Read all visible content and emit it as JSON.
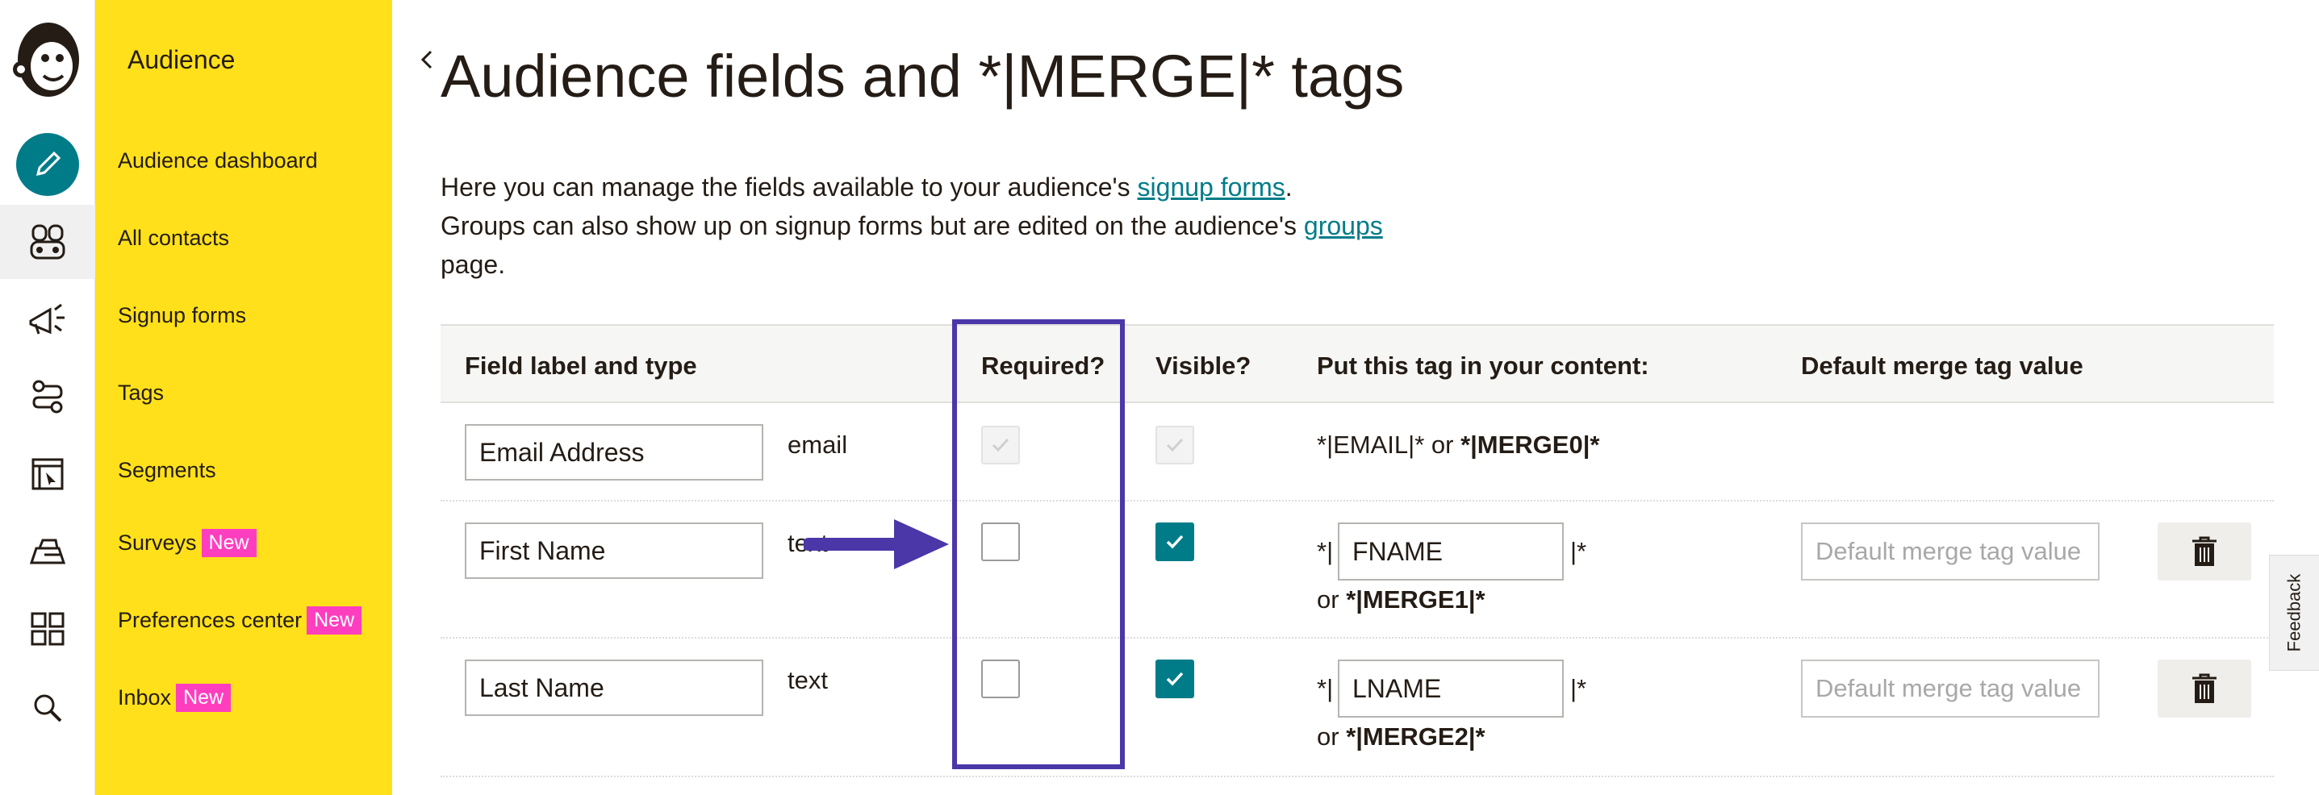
{
  "colors": {
    "brand_yellow": "#ffe01b",
    "teal": "#007c89",
    "badge_pink": "#ff3ebf",
    "annotation_purple": "#4b37a8"
  },
  "rail": {
    "icons": [
      "mailchimp-logo-icon",
      "create-pencil-icon",
      "audience-icon",
      "campaigns-megaphone-icon",
      "automations-icon",
      "website-icon",
      "integrations-icon",
      "apps-grid-icon",
      "search-icon"
    ]
  },
  "subnav": {
    "title": "Audience",
    "items": [
      {
        "label": "Audience dashboard",
        "badge": ""
      },
      {
        "label": "All contacts",
        "badge": ""
      },
      {
        "label": "Signup forms",
        "badge": ""
      },
      {
        "label": "Tags",
        "badge": ""
      },
      {
        "label": "Segments",
        "badge": ""
      },
      {
        "label": "Surveys",
        "badge": "New"
      },
      {
        "label": "Preferences center",
        "badge": "New"
      },
      {
        "label": "Inbox",
        "badge": "New"
      }
    ]
  },
  "page": {
    "title": "Audience fields and *|MERGE|* tags",
    "intro_1": "Here you can manage the fields available to your audience's ",
    "intro_link_1": "signup forms",
    "intro_1_end": ".",
    "intro_2": "Groups can also show up on signup forms but are edited on the audience's ",
    "intro_link_2": "groups",
    "intro_2_end": "page."
  },
  "table": {
    "headers": [
      "Field label and type",
      "Required?",
      "Visible?",
      "Put this tag in your content:",
      "Default merge tag value"
    ],
    "rows": [
      {
        "label": "Email Address",
        "type": "email",
        "required": true,
        "visible": true,
        "locked": true,
        "tag_text": "*|EMAIL|* or ",
        "merge": "*|MERGE0|*",
        "editable_tag": "",
        "default_placeholder": ""
      },
      {
        "label": "First Name",
        "type": "text",
        "required": false,
        "visible": true,
        "locked": false,
        "tag_prefix": "*|",
        "editable_tag": "FNAME",
        "tag_suffix": "|*",
        "or_text": "or ",
        "merge": "*|MERGE1|*",
        "default_placeholder": "Default merge tag value"
      },
      {
        "label": "Last Name",
        "type": "text",
        "required": false,
        "visible": true,
        "locked": false,
        "tag_prefix": "*|",
        "editable_tag": "LNAME",
        "tag_suffix": "|*",
        "or_text": "or ",
        "merge": "*|MERGE2|*",
        "default_placeholder": "Default merge tag value"
      }
    ]
  },
  "feedback_label": "Feedback"
}
